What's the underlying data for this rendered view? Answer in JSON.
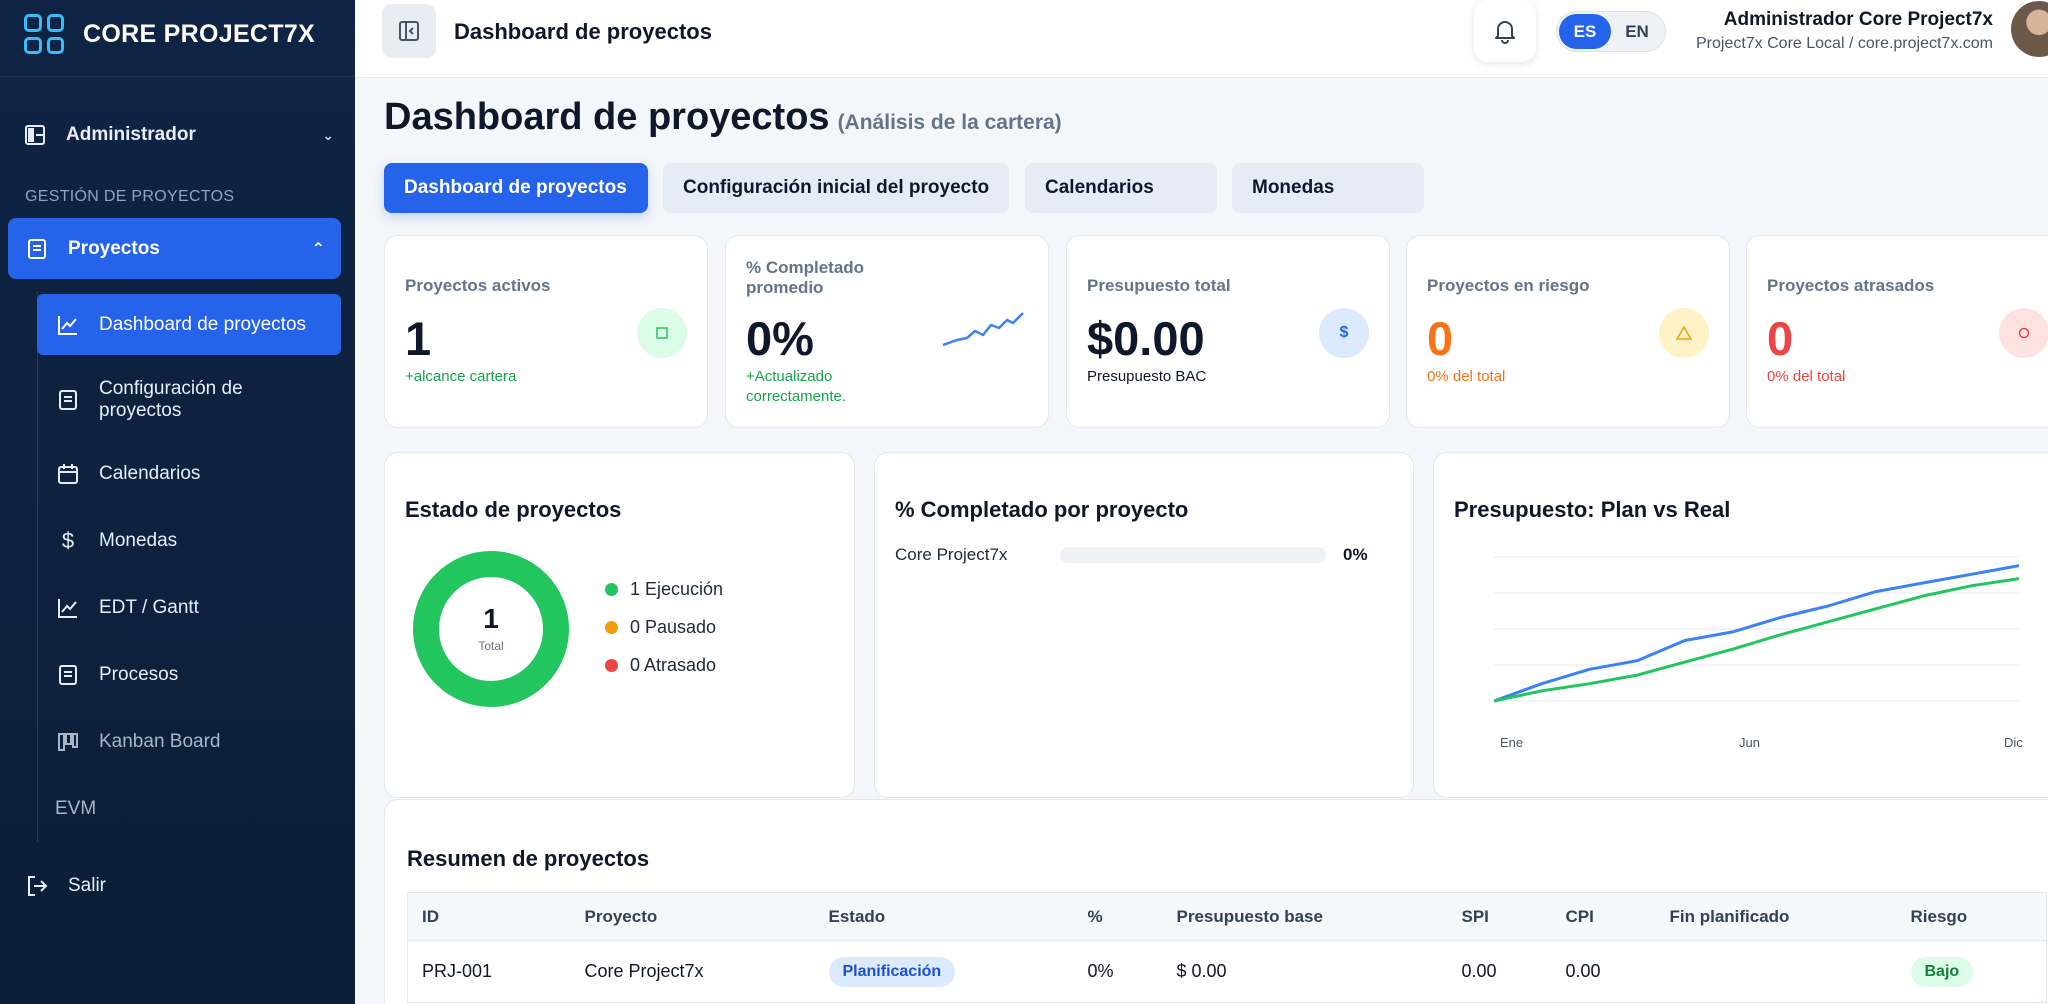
{
  "brand": {
    "name": "CORE PROJECT7X"
  },
  "sidebar": {
    "admin_label": "Administrador",
    "section_label": "GESTIÓN DE PROYECTOS",
    "projects_label": "Proyectos",
    "items": [
      {
        "label": "Dashboard de proyectos",
        "icon": "chart-line-icon"
      },
      {
        "label": "Configuración de proyectos",
        "icon": "document-icon"
      },
      {
        "label": "Calendarios",
        "icon": "calendar-icon"
      },
      {
        "label": "Monedas",
        "icon": "dollar-icon"
      },
      {
        "label": "EDT / Gantt",
        "icon": "chart-line-icon"
      },
      {
        "label": "Procesos",
        "icon": "document-icon"
      },
      {
        "label": "Kanban Board",
        "icon": "kanban-icon"
      },
      {
        "label": "EVM",
        "icon": ""
      }
    ],
    "exit_label": "Salir"
  },
  "topbar": {
    "title": "Dashboard de proyectos",
    "lang_es": "ES",
    "lang_en": "EN",
    "user_name": "Administrador Core Project7x",
    "user_sub": "Project7x Core Local / core.project7x.com"
  },
  "page": {
    "title": "Dashboard de proyectos",
    "subtitle": "(Análisis de la cartera)"
  },
  "tabs": [
    {
      "label": "Dashboard de proyectos"
    },
    {
      "label": "Configuración inicial del proyecto"
    },
    {
      "label": "Calendarios"
    },
    {
      "label": "Monedas"
    }
  ],
  "kpis": [
    {
      "label": "Proyectos activos",
      "value": "1",
      "note": "+alcance cartera",
      "icon": "square-icon"
    },
    {
      "label": "% Completado promedio",
      "value": "0%",
      "note": "+Actualizado correctamente.",
      "icon": "sparkline-icon"
    },
    {
      "label": "Presupuesto total",
      "value": "$0.00",
      "note": "Presupuesto BAC",
      "icon": "dollar-icon",
      "icon_text": "$"
    },
    {
      "label": "Proyectos en riesgo",
      "value": "0",
      "note": "0% del total",
      "icon": "warning-icon"
    },
    {
      "label": "Proyectos atrasados",
      "value": "0",
      "note": "0% del total",
      "icon": "circle-icon"
    }
  ],
  "colors": {
    "accent": "#2563eb",
    "green": "#22c55e",
    "orange": "#f97316",
    "amber": "#f59e0b",
    "red": "#ef4444",
    "sidebar_bg": "#0f2444"
  },
  "status_panel": {
    "title": "Estado de proyectos",
    "total_value": "1",
    "total_label": "Total",
    "legend": [
      {
        "label": "1 Ejecución",
        "color": "#22c55e"
      },
      {
        "label": "0 Pausado",
        "color": "#f59e0b"
      },
      {
        "label": "0 Atrasado",
        "color": "#ef4444"
      }
    ]
  },
  "progress_panel": {
    "title": "% Completado por proyecto",
    "rows": [
      {
        "name": "Core Project7x",
        "pct_label": "0%",
        "value": 0
      }
    ]
  },
  "budget_panel": {
    "title": "Presupuesto: Plan vs Real"
  },
  "chart_data": {
    "type": "line",
    "title": "Presupuesto: Plan vs Real",
    "x_tick_labels": [
      "Ene",
      "Jun",
      "Dic"
    ],
    "x": [
      "Ene",
      "Feb",
      "Mar",
      "Abr",
      "May",
      "Jun",
      "Jul",
      "Ago",
      "Sep",
      "Oct",
      "Nov",
      "Dic"
    ],
    "series": [
      {
        "color": "#3b82f6",
        "values": [
          0,
          12,
          22,
          28,
          42,
          48,
          58,
          66,
          76,
          82,
          88,
          94
        ]
      },
      {
        "color": "#22c55e",
        "values": [
          0,
          7,
          12,
          18,
          27,
          36,
          46,
          55,
          64,
          73,
          80,
          85
        ]
      }
    ],
    "ylim": [
      0,
      100
    ],
    "grid": true,
    "legend": "none"
  },
  "summary": {
    "title": "Resumen de proyectos",
    "columns": [
      "ID",
      "Proyecto",
      "Estado",
      "%",
      "Presupuesto base",
      "SPI",
      "CPI",
      "Fin planificado",
      "Riesgo"
    ],
    "rows": [
      {
        "id": "PRJ-001",
        "project": "Core Project7x",
        "status": "Planificación",
        "pct": "0%",
        "budget": "$ 0.00",
        "spi": "0.00",
        "cpi": "0.00",
        "end": "",
        "risk": "Bajo"
      }
    ]
  }
}
